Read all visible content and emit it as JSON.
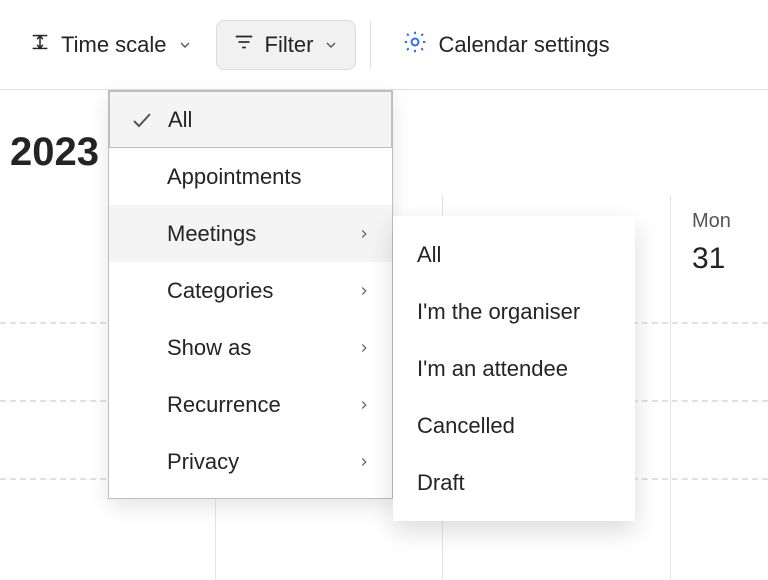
{
  "toolbar": {
    "time_scale_label": "Time scale",
    "filter_label": "Filter",
    "settings_label": "Calendar settings"
  },
  "year": "2023",
  "day_label": "Mon",
  "day_number": "31",
  "filter_menu": {
    "items": [
      {
        "label": "All",
        "checked": true,
        "has_sub": false
      },
      {
        "label": "Appointments",
        "checked": false,
        "has_sub": false
      },
      {
        "label": "Meetings",
        "checked": false,
        "has_sub": true,
        "hover": true
      },
      {
        "label": "Categories",
        "checked": false,
        "has_sub": true
      },
      {
        "label": "Show as",
        "checked": false,
        "has_sub": true
      },
      {
        "label": "Recurrence",
        "checked": false,
        "has_sub": true
      },
      {
        "label": "Privacy",
        "checked": false,
        "has_sub": true
      }
    ]
  },
  "meetings_submenu": {
    "items": [
      {
        "label": "All"
      },
      {
        "label": "I'm the organiser"
      },
      {
        "label": "I'm an attendee"
      },
      {
        "label": "Cancelled"
      },
      {
        "label": "Draft"
      }
    ]
  }
}
